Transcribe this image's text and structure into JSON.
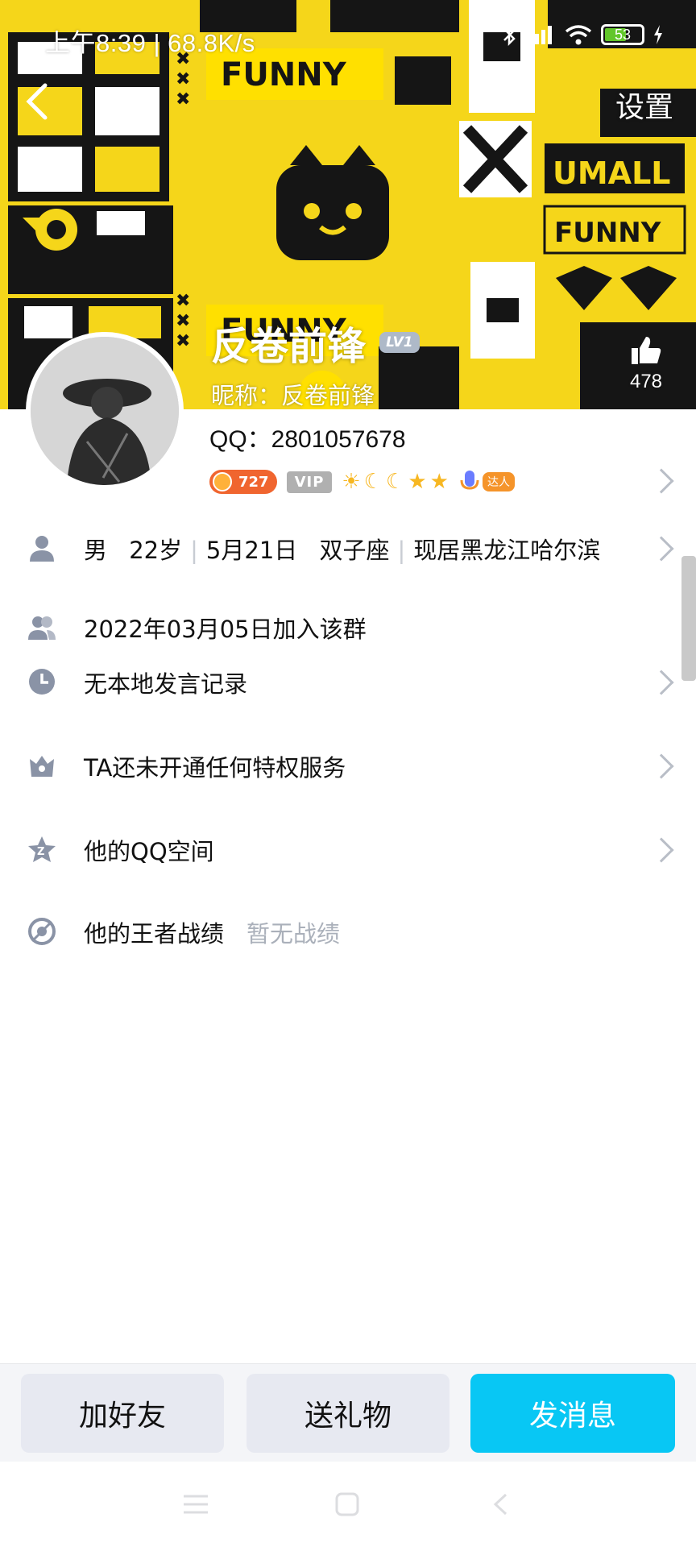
{
  "status_bar": {
    "time_text": "上午8:39 | 68.8K/s",
    "battery": "53"
  },
  "header": {
    "settings_label": "设置",
    "cover_texts": [
      "FUNNY",
      "UMALL",
      "FUNNY",
      "FUNNY"
    ]
  },
  "profile": {
    "display_name": "反卷前锋",
    "level_badge": "LV1",
    "nickname": "昵称：反卷前锋",
    "like_count": "478",
    "qq_number": "QQ：2801057678",
    "score_badge": "727",
    "vip_badge": "VIP",
    "talent_badge": "达人"
  },
  "info": {
    "gender": "男",
    "age": "22岁",
    "birthday": "5月21日",
    "zodiac": "双子座",
    "location": "现居黑龙江哈尔滨",
    "join_date": "2022年03月05日加入该群",
    "speech_record": "无本地发言记录",
    "privilege": "TA还未开通任何特权服务",
    "qzone": "他的QQ空间",
    "game_record": "他的王者战绩",
    "game_record_status": "暂无战绩"
  },
  "actions": {
    "add_friend": "加好友",
    "send_gift": "送礼物",
    "send_message": "发消息"
  },
  "colors": {
    "accent": "#08c7f4",
    "cover_yellow": "#f5d61a",
    "score_orange": "#f0652f"
  }
}
